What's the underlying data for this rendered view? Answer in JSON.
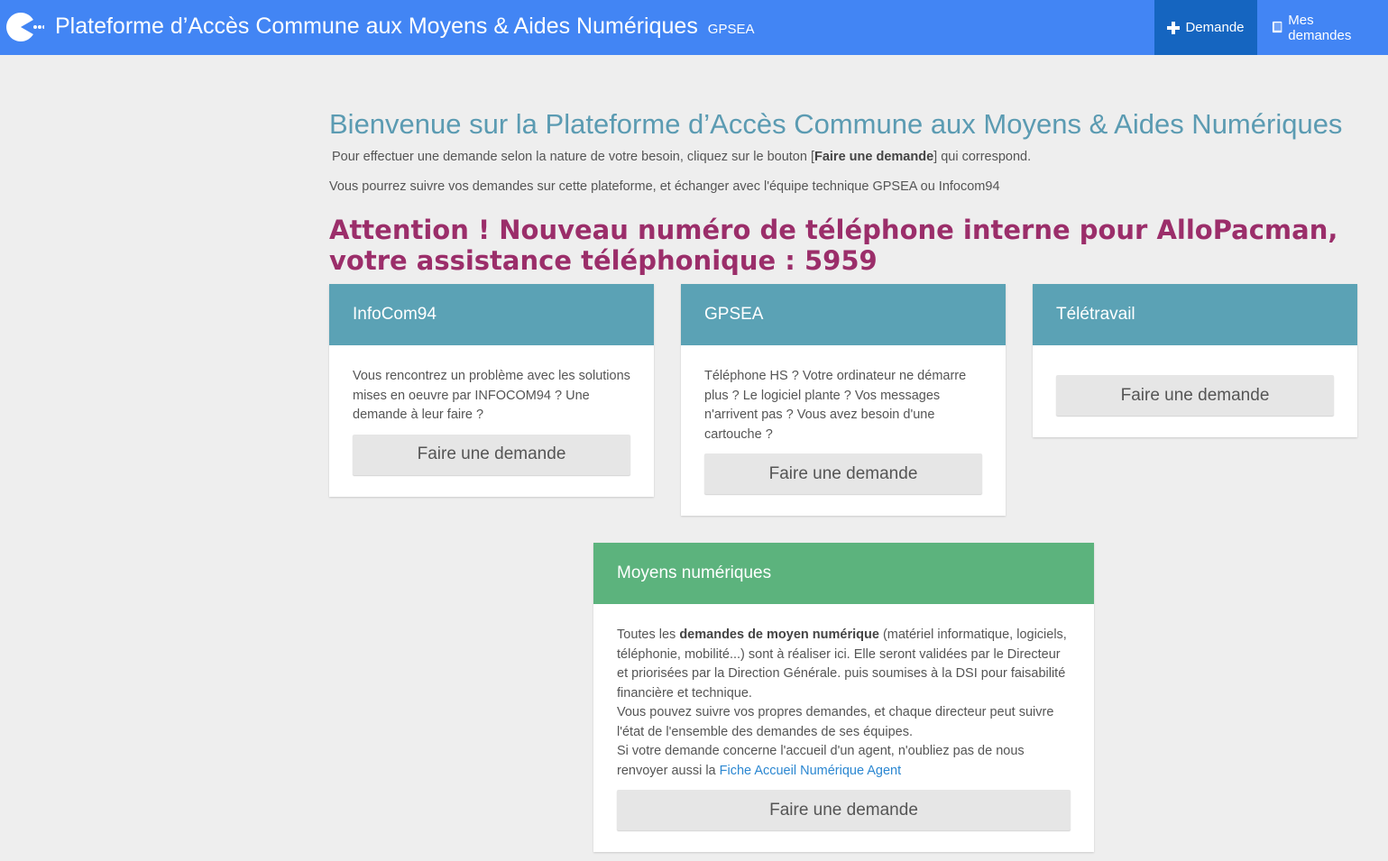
{
  "header": {
    "title": "Plateforme d’Accès Commune aux Moyens & Aides Numériques",
    "subtitle": "GPSEA",
    "nav": {
      "demande_label": "Demande",
      "mes_demandes_label": "Mes demandes"
    },
    "colors": {
      "bar": "#4285f4",
      "active": "#1565c0"
    }
  },
  "intro": {
    "title": "Bienvenue sur la Plateforme d’Accès Commune aux Moyens & Aides Numériques",
    "line1_before": "Pour effectuer une demande selon la nature de votre besoin, cliquez sur le bouton [",
    "line1_bold": "Faire une demande",
    "line1_after": "] qui correspond.",
    "line2": "Vous pourrez suivre vos demandes sur cette plateforme, et échanger avec l'équipe technique GPSEA ou Infocom94",
    "alert": "Attention ! Nouveau numéro de téléphone interne pour AlloPacman, votre assistance téléphonique : 5959"
  },
  "cards": {
    "infocom": {
      "title": "InfoCom94",
      "text": "Vous rencontrez un problème avec les solutions mises en oeuvre par INFOCOM94 ? Une demande à leur faire ?",
      "button": "Faire une demande"
    },
    "gpsea": {
      "title": "GPSEA",
      "text": "Téléphone HS ? Votre ordinateur ne démarre plus ? Le logiciel plante ? Vos messages n'arrivent pas ? Vous avez besoin d'une cartouche ?",
      "button": "Faire une demande"
    },
    "teletravail": {
      "title": "Télétravail",
      "button": "Faire une demande"
    },
    "moyens": {
      "title": "Moyens numériques",
      "p1_before": "Toutes les ",
      "p1_bold": "demandes de moyen numérique",
      "p1_after": " (matériel informatique, logiciels, téléphonie, mobilité...) sont à réaliser ici. Elle seront validées par le Directeur et priorisées par la Direction Générale. puis soumises à la DSI pour faisabilité financière et technique.",
      "p2": "Vous pouvez suivre vos propres demandes, et chaque directeur peut suivre l'état de l'ensemble des demandes de ses équipes.",
      "p3_before": "Si votre demande concerne l'accueil d'un agent, n'oubliez pas de nous renvoyer aussi la ",
      "p3_link": "Fiche Accueil Numérique Agent",
      "button": "Faire une demande"
    }
  },
  "icons": {
    "logo": "pacman-logo-icon",
    "demande": "plus-icon",
    "mes_demandes": "book-icon"
  }
}
